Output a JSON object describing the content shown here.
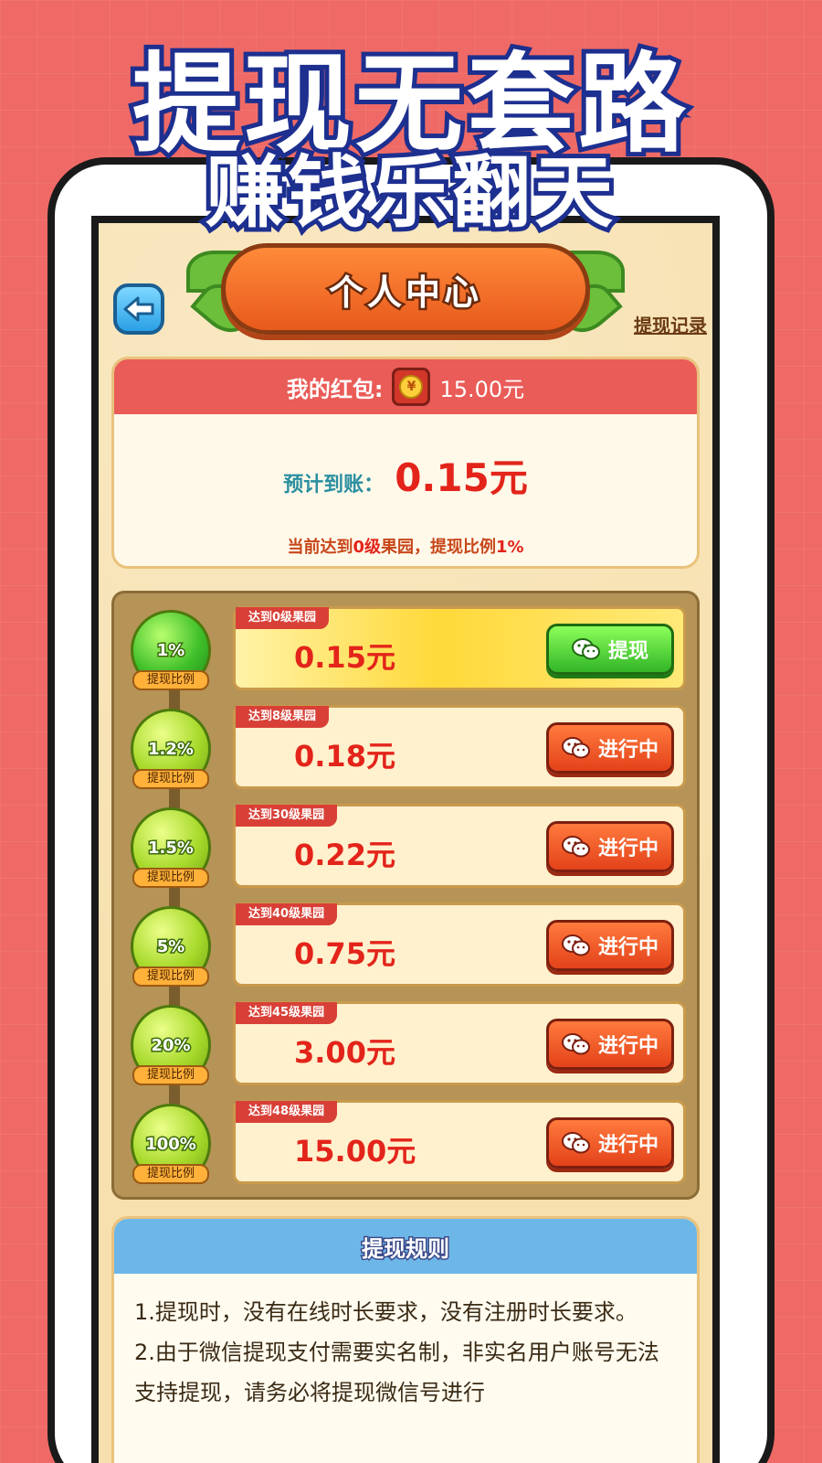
{
  "headline": {
    "line1": "提现无套路",
    "line2": "赚钱乐翻天"
  },
  "header": {
    "title": "个人中心",
    "history_link": "提现记录"
  },
  "wallet": {
    "label": "我的红包:",
    "coin_symbol": "¥",
    "balance": "15.00元",
    "expect_label": "预计到账：",
    "expect_value": "0.15元",
    "note_prefix": "当前达到",
    "note_level": "0级",
    "note_suffix": "果园，提现比例",
    "note_ratio": "1%"
  },
  "tiers": [
    {
      "ratio": "1%",
      "ratio_label": "提现比例",
      "requirement": "达到0级果园",
      "amount": "0.15元",
      "button": "提现",
      "state": "available"
    },
    {
      "ratio": "1.2%",
      "ratio_label": "提现比例",
      "requirement": "达到8级果园",
      "amount": "0.18元",
      "button": "进行中",
      "state": "in-progress"
    },
    {
      "ratio": "1.5%",
      "ratio_label": "提现比例",
      "requirement": "达到30级果园",
      "amount": "0.22元",
      "button": "进行中",
      "state": "in-progress"
    },
    {
      "ratio": "5%",
      "ratio_label": "提现比例",
      "requirement": "达到40级果园",
      "amount": "0.75元",
      "button": "进行中",
      "state": "in-progress"
    },
    {
      "ratio": "20%",
      "ratio_label": "提现比例",
      "requirement": "达到45级果园",
      "amount": "3.00元",
      "button": "进行中",
      "state": "in-progress"
    },
    {
      "ratio": "100%",
      "ratio_label": "提现比例",
      "requirement": "达到48级果园",
      "amount": "15.00元",
      "button": "进行中",
      "state": "in-progress"
    }
  ],
  "rules": {
    "title": "提现规则",
    "items": [
      "1.提现时，没有在线时长要求，没有注册时长要求。",
      "2.由于微信提现支付需要实名制，非实名用户账号无法支持提现，请务必将提现微信号进行"
    ]
  },
  "colors": {
    "background": "#ef6a66",
    "accent_red": "#e3241a",
    "green_button": "#32b528",
    "orange_button": "#e3421a"
  }
}
